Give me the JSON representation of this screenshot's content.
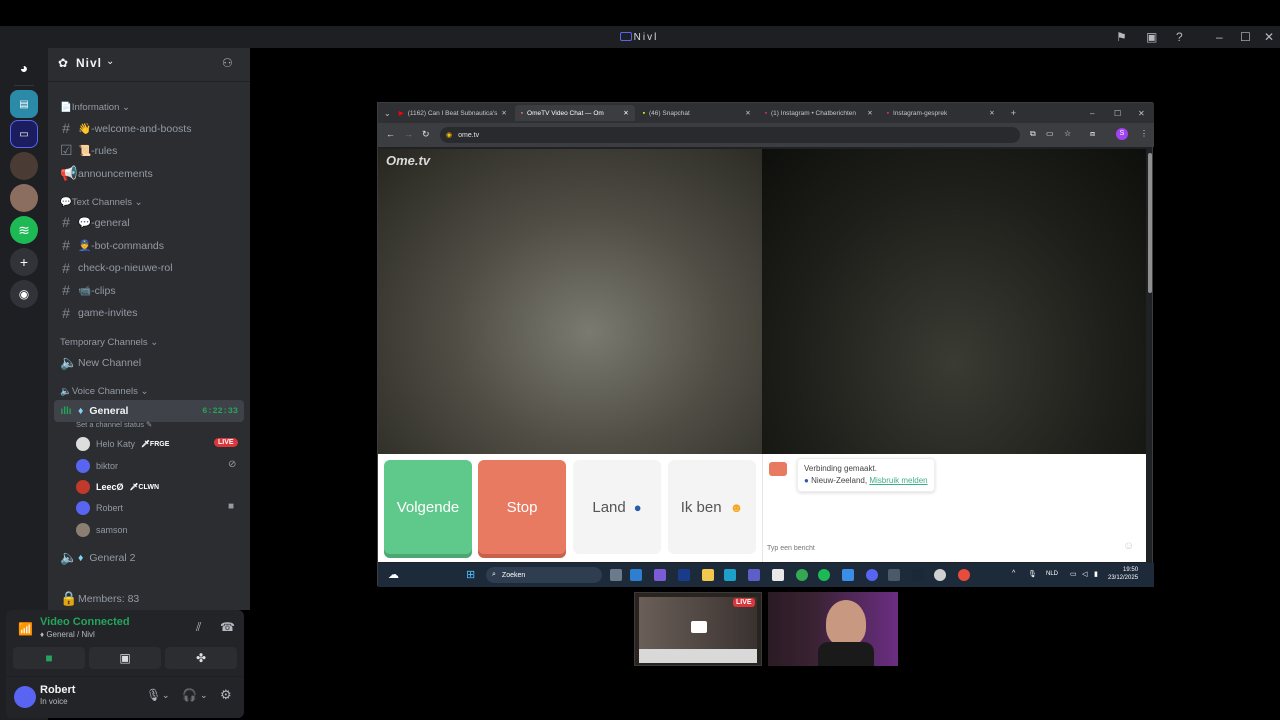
{
  "window": {
    "title": "Nivl"
  },
  "server": {
    "name": "Nivl",
    "categories": {
      "information": "Information",
      "text": "Text Channels",
      "temporary": "Temporary Channels",
      "voice": "Voice Channels"
    },
    "info_channels": [
      "👋-welcome-and-boosts",
      "📜-rules",
      "announcements"
    ],
    "text_channels": [
      "💬-general",
      "👮-bot-commands",
      "check-op-nieuwe-rol",
      "📹-clips",
      "game-invites"
    ],
    "temp_channels": [
      "New Channel"
    ],
    "voice_general": {
      "name": "General",
      "timer": "6:22:33",
      "status": "Set a channel status"
    },
    "voice_users": [
      {
        "name": "Helo Katy",
        "tag": "FRGE",
        "live": "LIVE"
      },
      {
        "name": "biktor"
      },
      {
        "name": "LeecØ",
        "tag": "CLWN"
      },
      {
        "name": "Robert"
      },
      {
        "name": "samson"
      }
    ],
    "voice_general2": "General 2",
    "members": "Members: 83"
  },
  "voice_panel": {
    "status": "Video Connected",
    "location": "General / Nivl"
  },
  "user": {
    "name": "Robert",
    "status": "In voice"
  },
  "browser": {
    "tabs": [
      "(1162) Can I Beat Subnautica's",
      "OmeTV Video Chat — Om",
      "(46) Snapchat",
      "(1) Instagram • Chatberichten",
      "Instagram-gesprek"
    ],
    "url": "ome.tv"
  },
  "ometv": {
    "logo": "Ome.tv",
    "buttons": {
      "next": "Volgende",
      "stop": "Stop",
      "country": "Land",
      "iam": "Ik ben"
    },
    "chat_connected": "Verbinding gemaakt.",
    "chat_country": "Nieuw-Zeeland,",
    "chat_report": "Misbruik melden",
    "chat_placeholder": "Typ een bericht"
  },
  "taskbar": {
    "search": "Zoeken",
    "lang": "NLD",
    "time": "19:50",
    "date": "23/12/2025"
  },
  "stream_badge": "LIVE",
  "colors": {
    "accent": "#5865f2",
    "connected": "#23a55a",
    "live": "#da373c",
    "next_btn": "#5ec98a",
    "stop_btn": "#e97a62"
  }
}
